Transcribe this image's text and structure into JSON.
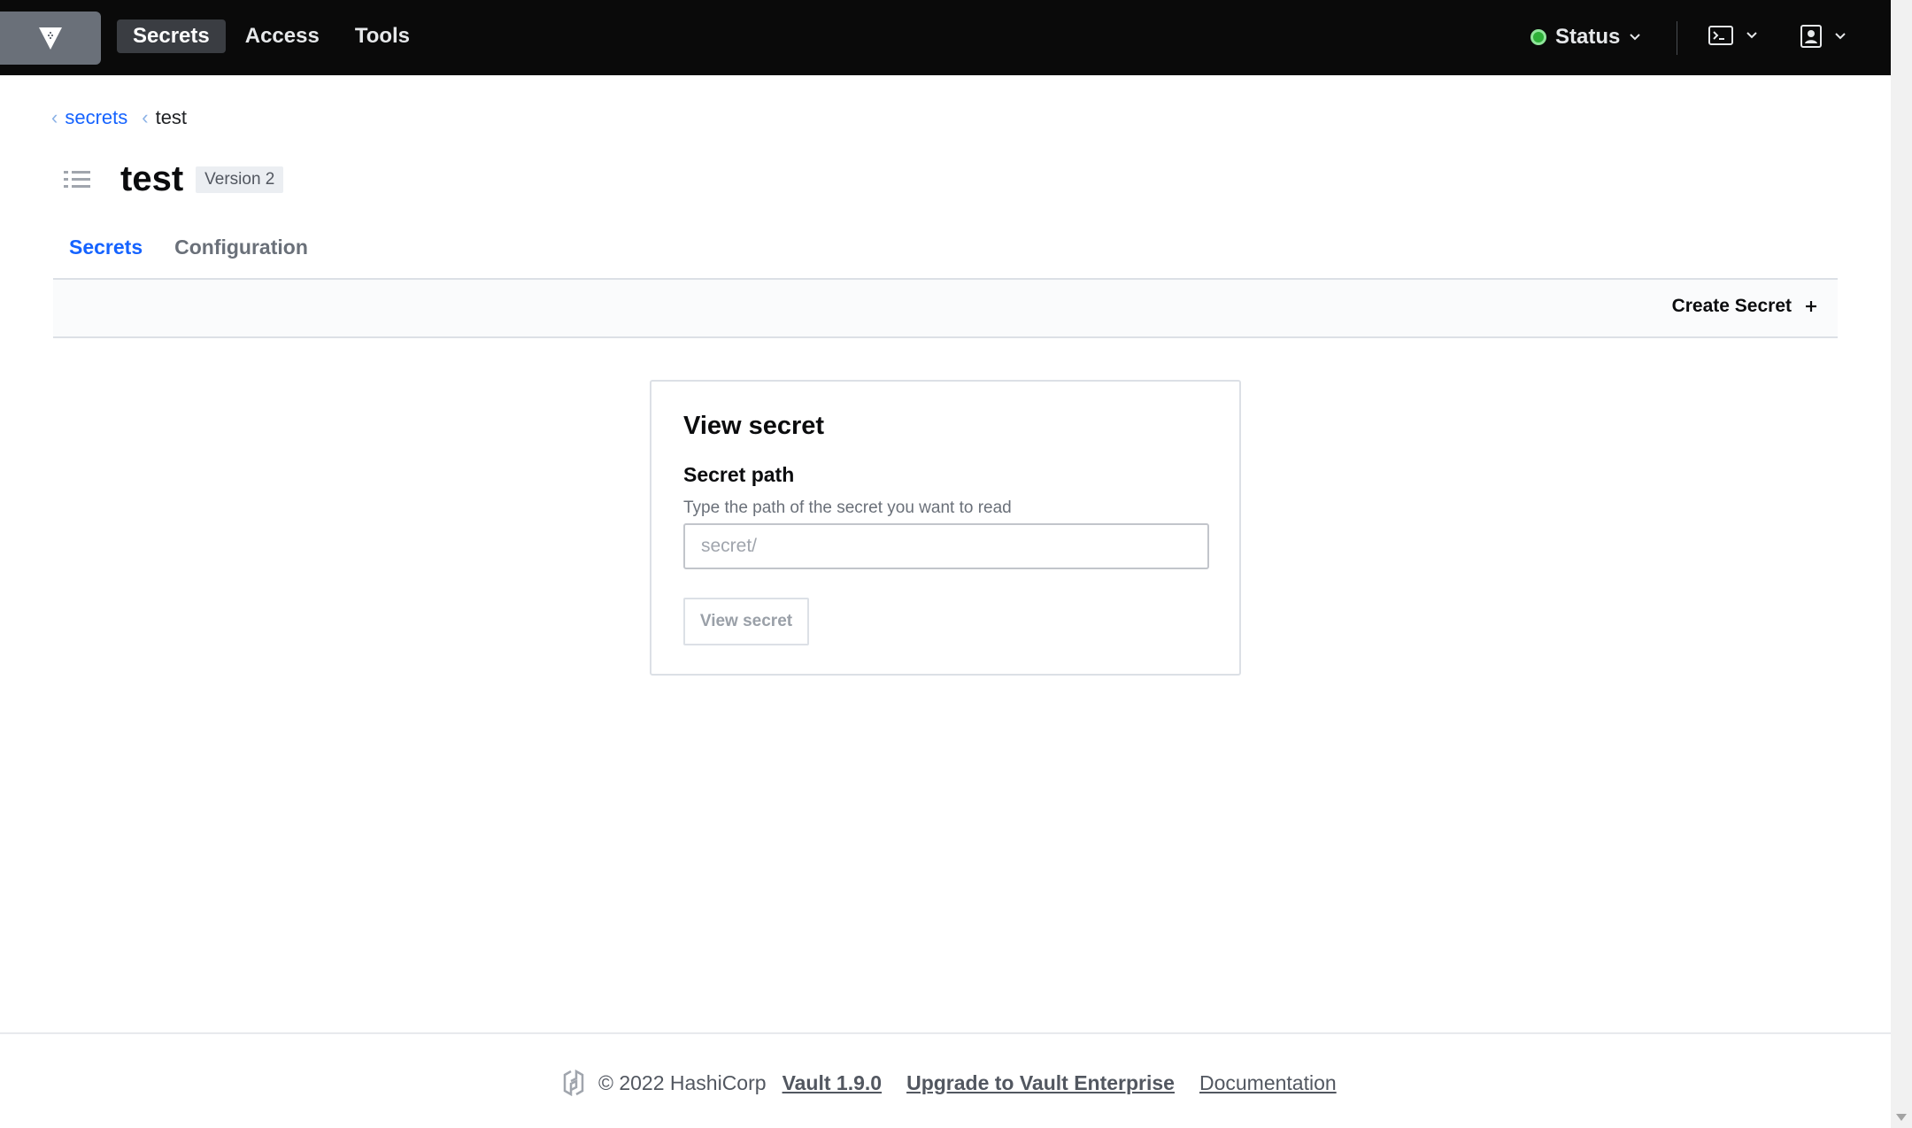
{
  "nav": {
    "logo": "vault-logo-icon",
    "links": [
      {
        "label": "Secrets",
        "active": true
      },
      {
        "label": "Access",
        "active": false
      },
      {
        "label": "Tools",
        "active": false
      }
    ],
    "status_label": "Status",
    "status_color": "#2eb039"
  },
  "breadcrumb": {
    "parent": "secrets",
    "current": "test"
  },
  "header": {
    "title": "test",
    "version": "Version 2"
  },
  "tabs": [
    {
      "label": "Secrets",
      "active": true
    },
    {
      "label": "Configuration",
      "active": false
    }
  ],
  "toolbar": {
    "create_label": "Create Secret"
  },
  "card": {
    "title": "View secret",
    "field_label": "Secret path",
    "help_text": "Type the path of the secret you want to read",
    "input_placeholder": "secret/",
    "input_value": "",
    "button_label": "View secret"
  },
  "footer": {
    "copyright": "© 2022 HashiCorp",
    "version_link": "Vault 1.9.0",
    "upgrade_link": "Upgrade to Vault Enterprise",
    "docs_link": "Documentation"
  },
  "colors": {
    "accent": "#1563ff",
    "nav_bg": "#0a0a0a"
  }
}
